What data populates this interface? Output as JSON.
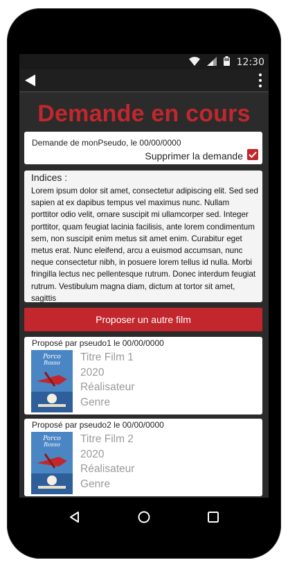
{
  "status_bar": {
    "time": "12:30",
    "icons": [
      "wifi-icon",
      "signal-icon",
      "battery-icon"
    ]
  },
  "app_bar": {
    "back_icon": "back-arrow-icon",
    "menu_icon": "overflow-menu-icon"
  },
  "page": {
    "title": "Demande en cours"
  },
  "request": {
    "info": "Demande de monPseudo, le 00/00/0000",
    "delete_label": "Supprimer la demande",
    "delete_checked": true
  },
  "hints": {
    "label": "Indices :",
    "text": "Lorem ipsum dolor sit amet, consectetur adipiscing elit. Sed sed sapien at ex dapibus tempus vel maximus nunc. Nullam porttitor odio velit, ornare suscipit mi ullamcorper sed. Integer porttitor, quam feugiat lacinia facilisis, ante lorem condimentum sem, non suscipit enim metus sit amet enim. Curabitur eget metus erat. Nunc eleifend, arcu a euismod accumsan, nunc neque consectetur nibh, in posuere lorem tellus id nulla. Morbi fringilla lectus nec pellentesque rutrum. Donec interdum feugiat rutrum. Vestibulum magna diam, dictum at tortor sit amet, sagittis"
  },
  "propose_button": {
    "label": "Proposer un autre film"
  },
  "proposals": [
    {
      "proposed_by": "Proposé par pseudo1 le 00/00/0000",
      "title": "Titre Film 1",
      "year": "2020",
      "director": "Réalisateur",
      "genre": "Genre"
    },
    {
      "proposed_by": "Proposé par pseudo2 le 00/00/0000",
      "title": "Titre Film 2",
      "year": "2020",
      "director": "Réalisateur",
      "genre": "Genre"
    }
  ],
  "colors": {
    "accent": "#c1272d",
    "background": "#2b2b2b",
    "card": "#ffffff",
    "muted_text": "#9a9a9a"
  },
  "nav_bar": {
    "icons": [
      "nav-back-icon",
      "nav-home-icon",
      "nav-recents-icon"
    ]
  }
}
